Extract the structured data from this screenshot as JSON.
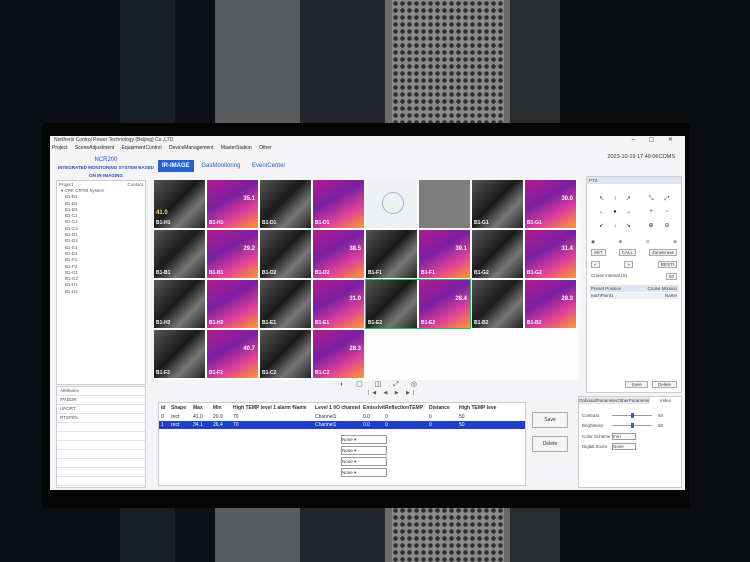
{
  "window": {
    "title": "Northeris Control Power Technology (Beijing) Co.,LTD",
    "controls": "– ▢ ✕"
  },
  "menu": [
    "Project",
    "SceneAdjustment",
    "EquipmentControl",
    "DeviceManagement",
    "MasterStation",
    "Other"
  ],
  "brand": {
    "line1": "NCR200",
    "line2": "INTEGRATED MONITORING SYSTEM BASED ON IR-IMAGING"
  },
  "tabs": [
    {
      "label": "IR-IMAGE",
      "active": true
    },
    {
      "label": "GasMonitoring",
      "active": false
    },
    {
      "label": "EventCenter",
      "active": false
    }
  ],
  "datetime": "2023-10-19 17:49:06COMS",
  "tree": {
    "header_left": "Project",
    "header_right": "Contact",
    "root": "CRK CRTM System",
    "items": [
      "B1-B1",
      "B1-B2",
      "B1-B3",
      "B1-C1",
      "B1-C2",
      "B1-C3",
      "B1-D1",
      "B1-D2",
      "B1-E1",
      "B1-E2",
      "B1-F1",
      "B1-F2",
      "B1-G1",
      "B1-G2",
      "B1-H1",
      "B1-H2"
    ]
  },
  "attributes": {
    "title": "Attributes",
    "rows": [
      "IPADDR",
      "UPORT",
      "RTSPIDL",
      "",
      "",
      "",
      "",
      "",
      "",
      ""
    ]
  },
  "cameras": [
    {
      "label": "B1-H1",
      "temp": "35.1",
      "temp2": "41.0"
    },
    {
      "label": "B1-D1",
      "temp": "",
      "temp2": ""
    },
    {
      "label": "",
      "temp": "",
      "temp2": "",
      "placeholder": true
    },
    {
      "label": "B1-G1",
      "temp": "30.0",
      "temp2": ""
    },
    {
      "label": "B1-B1",
      "temp": "29.2",
      "temp2": ""
    },
    {
      "label": "B1-D2",
      "temp": "38.5",
      "temp2": ""
    },
    {
      "label": "B1-F1",
      "temp": "39.1",
      "temp2": ""
    },
    {
      "label": "B1-G2",
      "temp": "31.4",
      "temp2": ""
    },
    {
      "label": "B1-H2",
      "temp": "",
      "temp2": "",
      "selected": false
    },
    {
      "label": "B1-E1",
      "temp": "31.0",
      "temp2": ""
    },
    {
      "label": "B1-E2",
      "temp": "28.4",
      "temp2": "",
      "selected": true
    },
    {
      "label": "B1-B2",
      "temp": "28.3",
      "temp2": ""
    },
    {
      "label": "B1-F2",
      "temp": "40.7",
      "temp2": ""
    },
    {
      "label": "B1-C2",
      "temp": "28.3",
      "temp2": ""
    }
  ],
  "grid_controls": "◐ ▢ ◫ ⤢ ◎",
  "pager": "|◀ ◀ ▶ ▶|",
  "ptz": {
    "title": "PTZ",
    "dpad": [
      "↖",
      "↑",
      "↗",
      "←",
      "●",
      "→",
      "↙",
      "↓",
      "↘"
    ],
    "zoom": [
      "⤡",
      "⤢",
      "+",
      "−",
      "⊕",
      "⊖"
    ],
    "row1": [
      "◉",
      "⊕",
      "⊙",
      "⊗"
    ],
    "row2_buttons": [
      "SET",
      "CALL",
      "ZoneErase"
    ],
    "row3": [
      "«",
      "»",
      "RESTI"
    ],
    "cruise_label": "Cruise interval (S)",
    "cruise_value": "60",
    "preset_head": [
      "Preset Position",
      "Cruise Mission"
    ],
    "preset_row": [
      "eachPoint1",
      "Name"
    ],
    "btn_save": "Save",
    "btn_delete": "Delete"
  },
  "table": {
    "headers": [
      "id",
      "Shape",
      "Max",
      "Min",
      "High TEMP level 1 alarm value",
      "Name",
      "Level 1 I/O channel",
      "Emissivity",
      "ReflectionTEMP",
      "Distance",
      "High TEMP leve"
    ],
    "rows": [
      {
        "cells": [
          "0",
          "rect",
          "41.0",
          "20.9",
          "70",
          "",
          "Channel1",
          "0.0",
          "0",
          "0",
          "50"
        ],
        "selected": false
      },
      {
        "cells": [
          "1",
          "rect",
          "34.1",
          "26.4",
          "70",
          "",
          "Channel1",
          "0.0",
          "0",
          "0",
          "50"
        ],
        "selected": true
      }
    ],
    "dropdowns": [
      "None",
      "None",
      "None",
      "None"
    ],
    "save": "Save",
    "delete": "Delete"
  },
  "settings": {
    "tabs": [
      "OnboardParameter",
      "OtherParameter",
      "Video"
    ],
    "active_tab": "Video",
    "sliders": [
      {
        "label": "Contrast",
        "value": 50,
        "readout": "50"
      },
      {
        "label": "Brightness",
        "value": 50,
        "readout": "50"
      }
    ],
    "selects": [
      {
        "label": "Color Scheme",
        "value": "Iron"
      },
      {
        "label": "Digital Zoom",
        "value": "None"
      }
    ]
  }
}
